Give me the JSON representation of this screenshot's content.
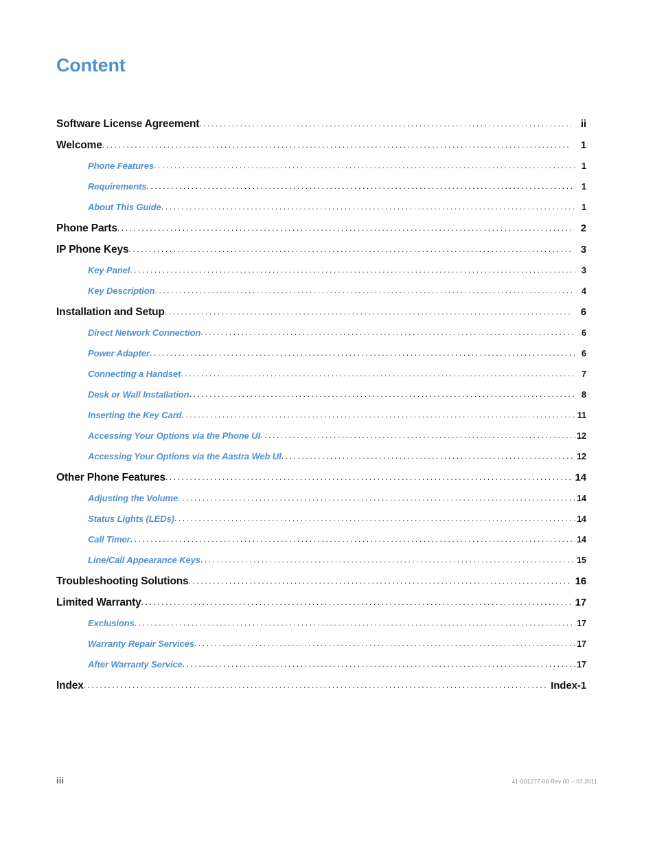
{
  "document": {
    "title": "Content",
    "title_color": "#4f91cd",
    "level1_color": "#111111",
    "level2_color": "#4f91cd"
  },
  "toc": {
    "entries": [
      {
        "level": 1,
        "label": "Software License Agreement",
        "page": "ii"
      },
      {
        "level": 1,
        "label": "Welcome",
        "page": "1"
      },
      {
        "level": 2,
        "label": "Phone Features",
        "page": "1"
      },
      {
        "level": 2,
        "label": "Requirements",
        "page": "1"
      },
      {
        "level": 2,
        "label": "About This Guide",
        "page": "1"
      },
      {
        "level": 1,
        "label": "Phone Parts",
        "page": "2"
      },
      {
        "level": 1,
        "label": "IP Phone Keys",
        "page": "3"
      },
      {
        "level": 2,
        "label": "Key Panel",
        "page": "3"
      },
      {
        "level": 2,
        "label": "Key Description",
        "page": "4"
      },
      {
        "level": 1,
        "label": "Installation and Setup",
        "page": "6"
      },
      {
        "level": 2,
        "label": "Direct Network Connection",
        "page": "6"
      },
      {
        "level": 2,
        "label": "Power Adapter",
        "page": "6"
      },
      {
        "level": 2,
        "label": "Connecting a Handset",
        "page": "7"
      },
      {
        "level": 2,
        "label": "Desk or Wall Installation",
        "page": "8"
      },
      {
        "level": 2,
        "label": "Inserting the Key Card",
        "page": "11"
      },
      {
        "level": 2,
        "label": "Accessing Your Options via the Phone UI",
        "page": "12"
      },
      {
        "level": 2,
        "label": "Accessing Your Options via the Aastra Web UI",
        "page": "12"
      },
      {
        "level": 1,
        "label": "Other Phone Features",
        "page": "14"
      },
      {
        "level": 2,
        "label": "Adjusting the Volume",
        "page": "14"
      },
      {
        "level": 2,
        "label": "Status Lights (LEDs)",
        "page": "14"
      },
      {
        "level": 2,
        "label": "Call Timer",
        "page": "14"
      },
      {
        "level": 2,
        "label": "Line/Call Appearance Keys",
        "page": "15"
      },
      {
        "level": 1,
        "label": "Troubleshooting Solutions",
        "page": "16"
      },
      {
        "level": 1,
        "label": "Limited Warranty",
        "page": "17"
      },
      {
        "level": 2,
        "label": "Exclusions",
        "page": "17"
      },
      {
        "level": 2,
        "label": "Warranty Repair Services",
        "page": "17"
      },
      {
        "level": 2,
        "label": "After Warranty Service",
        "page": "17"
      },
      {
        "level": 1,
        "label": "Index",
        "page": "Index-1"
      }
    ],
    "leader_char": "."
  },
  "footer": {
    "page_number": "iii",
    "document_code": "41-001277-06 Rev 00 – 07.2011"
  }
}
